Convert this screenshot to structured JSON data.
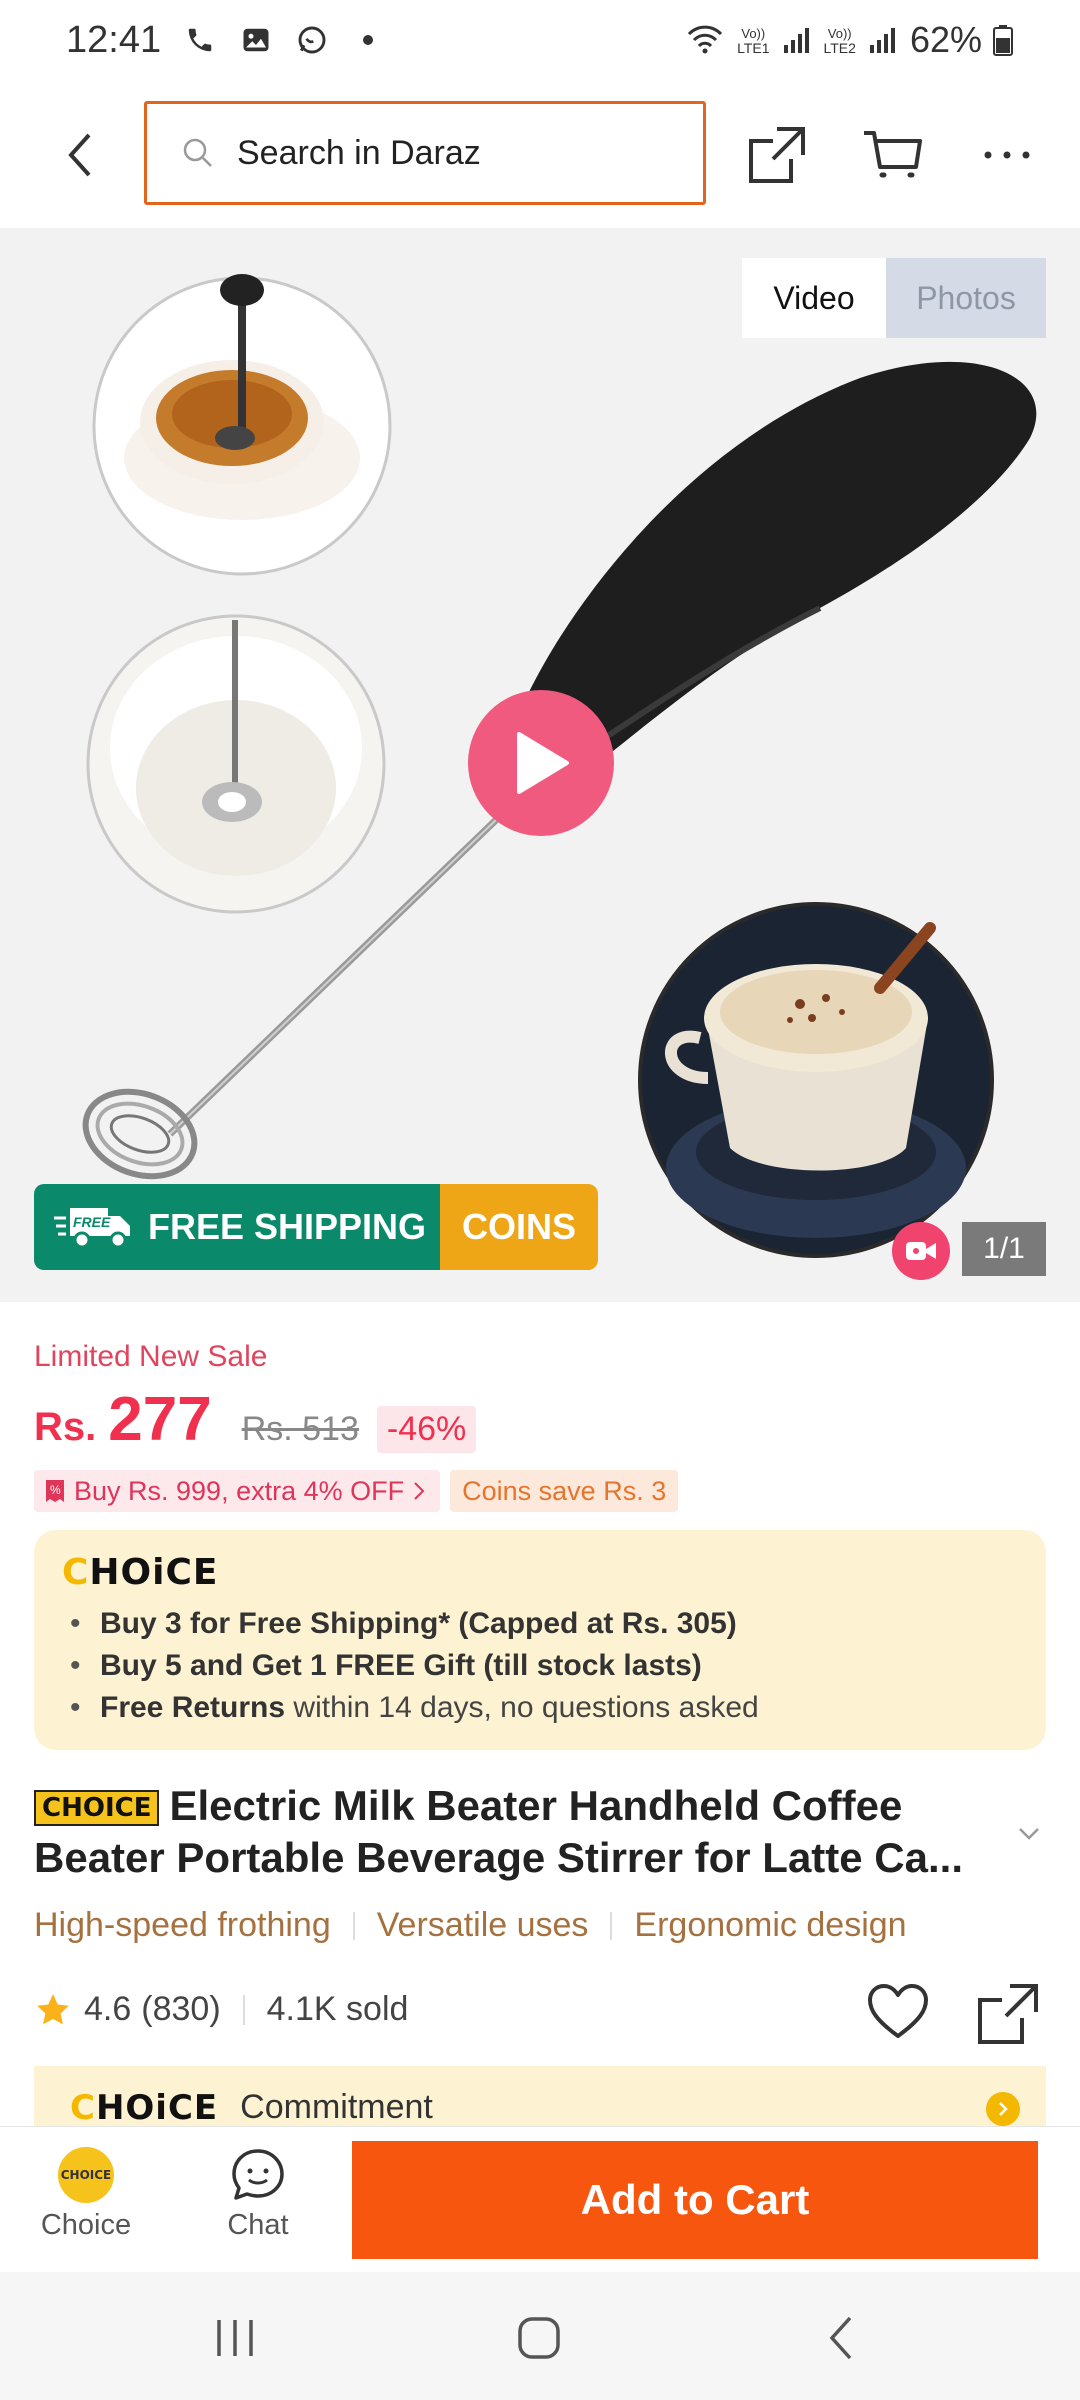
{
  "status_bar": {
    "time": "12:41",
    "battery": "62%",
    "lte1": "LTE1",
    "lte2": "LTE2",
    "icons": [
      "phone-icon",
      "gallery-icon",
      "chat-icon",
      "dot-icon",
      "wifi-icon",
      "signal-icon",
      "battery-icon"
    ]
  },
  "header": {
    "search_placeholder": "Search in Daraz",
    "icons": [
      "back-icon",
      "search-icon",
      "share-icon",
      "cart-icon",
      "more-icon"
    ]
  },
  "gallery": {
    "tabs": [
      "Video",
      "Photos"
    ],
    "active_tab": "Video",
    "free_shipping": "FREE SHIPPING",
    "free_badge": "FREE",
    "coins": "COINS",
    "counter": "1/1"
  },
  "price": {
    "sale_label": "Limited New Sale",
    "currency": "Rs.",
    "current": "277",
    "original": "Rs. 513",
    "discount": "-46%",
    "promo_offer": "Buy Rs. 999, extra 4% OFF",
    "coins_save": "Coins save Rs. 3"
  },
  "choice": {
    "logo": "CHOICE",
    "items": [
      {
        "bold": "Buy 3 for  Free Shipping* (Capped at Rs. 305)",
        "rest": ""
      },
      {
        "bold": "Buy 5 and Get 1 FREE Gift (till stock lasts)",
        "rest": ""
      },
      {
        "bold": "Free Returns",
        "rest": " within 14 days, no questions asked"
      }
    ]
  },
  "product": {
    "badge": "CHOICE",
    "title": "Electric Milk Beater Handheld Coffee Beater Portable Beverage Stirrer for Latte Ca...",
    "features": [
      "High-speed frothing",
      "Versatile uses",
      "Ergonomic design"
    ],
    "rating": "4.6",
    "reviews": "(830)",
    "sold": "4.1K sold"
  },
  "commitment": {
    "logo": "CHOICE",
    "label": "Commitment"
  },
  "bottom_bar": {
    "choice_label": "Choice",
    "choice_icon_text": "CHOICE",
    "chat_label": "Chat",
    "add_to_cart": "Add to Cart"
  },
  "colors": {
    "accent_orange": "#f7560f",
    "price_red": "#f0304e",
    "choice_yellow": "#f6c21c",
    "shipping_green": "#0a8a6a"
  }
}
